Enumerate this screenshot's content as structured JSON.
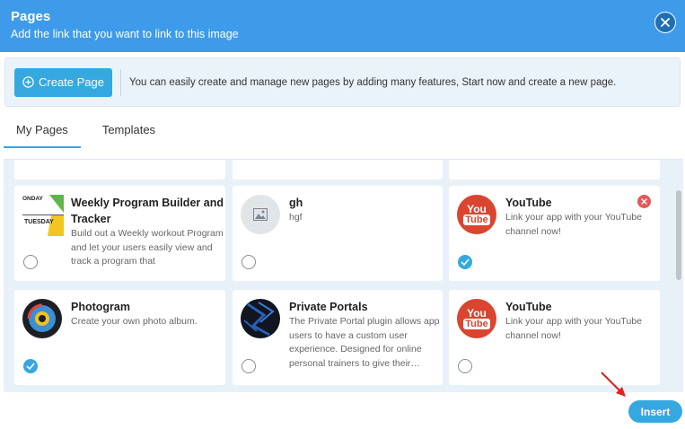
{
  "header": {
    "title": "Pages",
    "subtitle": "Add the link that you want to link to this image",
    "close_icon": "close-icon"
  },
  "toolbar": {
    "create_label": "Create Page",
    "info": "You can easily create and manage new pages by adding many features, Start now and create a new page."
  },
  "tabs": [
    {
      "label": "My Pages",
      "active": true
    },
    {
      "label": "Templates",
      "active": false
    }
  ],
  "cards": [
    {
      "title": "Weekly Program Builder and Tracker",
      "description": "Build out a Weekly workout Program and let your users easily view and track a program that",
      "thumb_text": [
        "ONDAY",
        "TUESDAY"
      ],
      "selected": false
    },
    {
      "title": "gh",
      "description": "hgf",
      "thumb_icon": "image-icon",
      "selected": false
    },
    {
      "title": "YouTube",
      "description": "Link your app with your YouTube channel now!",
      "thumb_text": [
        "You",
        "Tube"
      ],
      "selected": true,
      "removable": true
    },
    {
      "title": "Photogram",
      "description": "Create your own photo album.",
      "selected": true
    },
    {
      "title": "Private Portals",
      "description": "The Private Portal plugin allows app users to have a custom user experience. Designed for online personal trainers to give their…",
      "selected": false
    },
    {
      "title": "YouTube",
      "description": "Link your app with your YouTube channel now!",
      "thumb_text": [
        "You",
        "Tube"
      ],
      "selected": false
    }
  ],
  "footer": {
    "insert_label": "Insert"
  },
  "colors": {
    "header": "#3d9be9",
    "accent": "#35a8e0",
    "remove": "#e05a5a",
    "youtube": "#d9452f"
  }
}
